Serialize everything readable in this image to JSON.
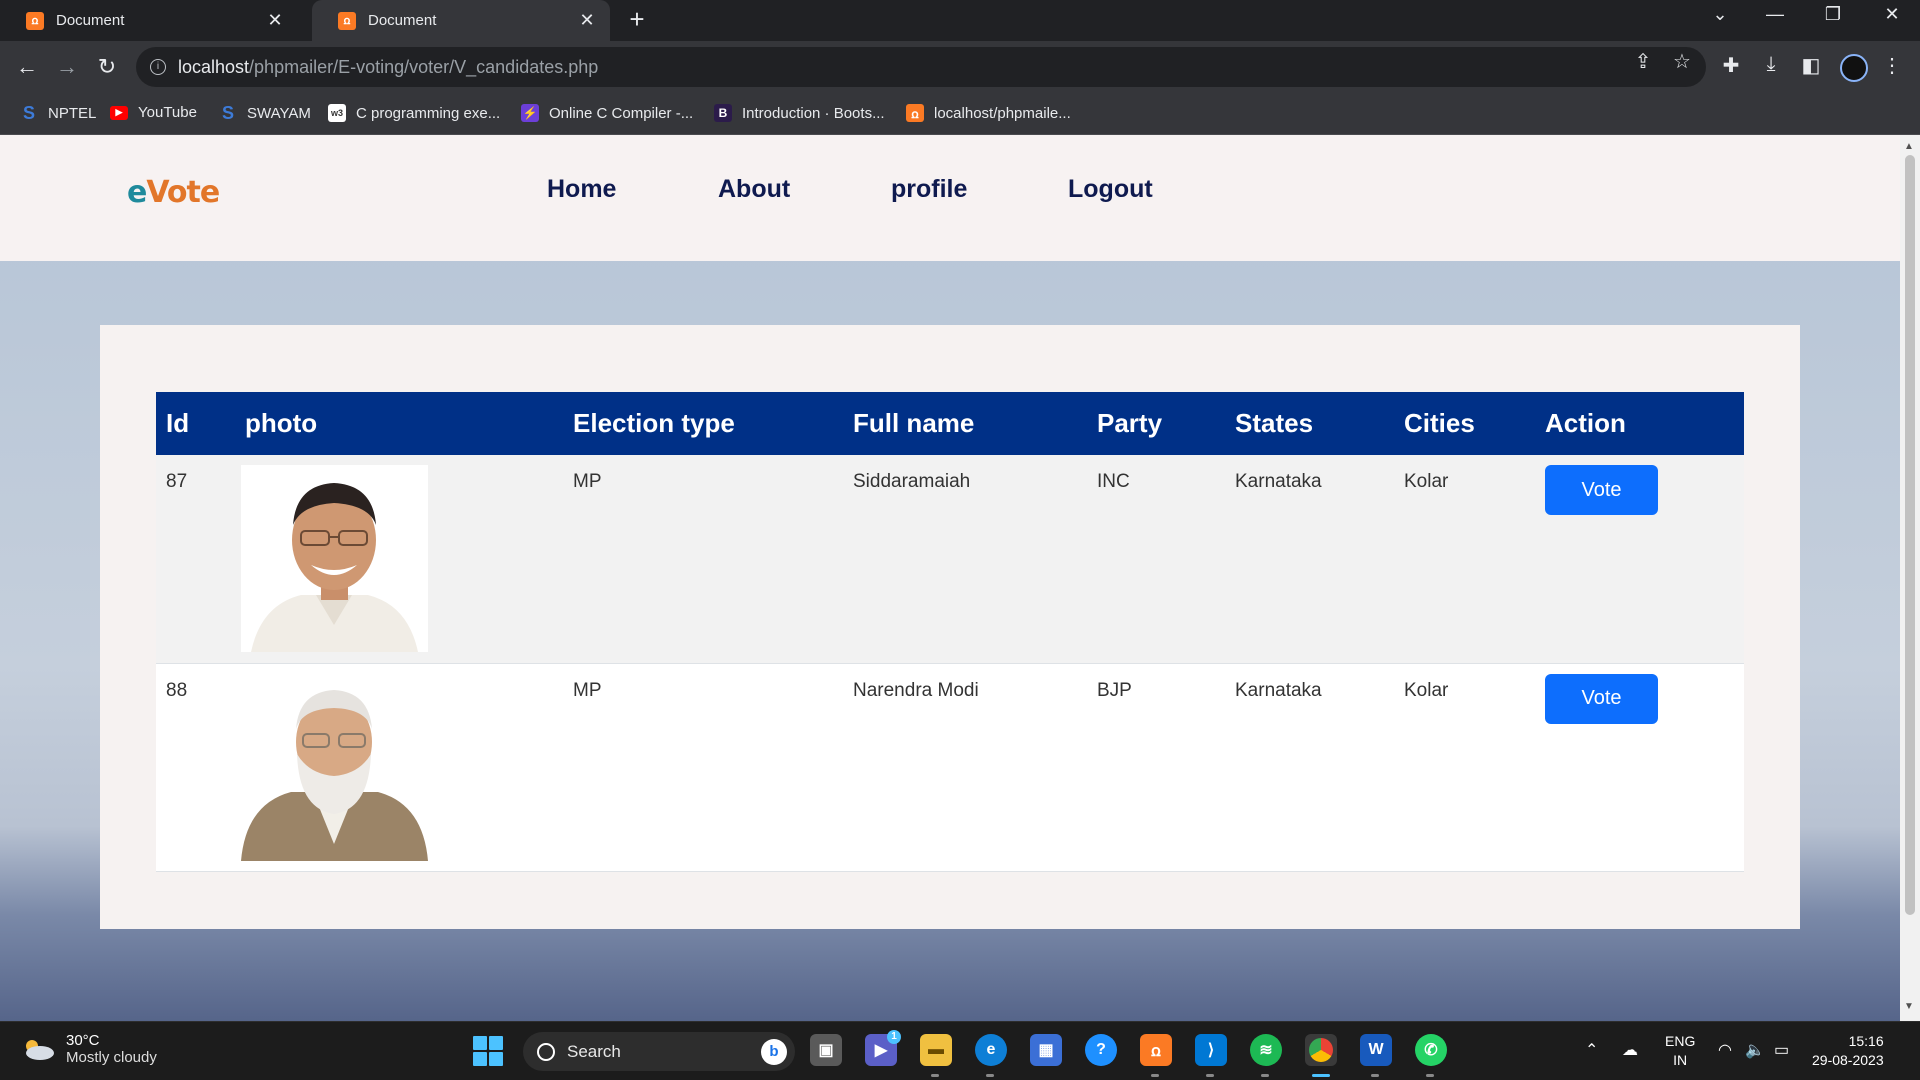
{
  "browser": {
    "tabs": [
      {
        "title": "Document",
        "active": false
      },
      {
        "title": "Document",
        "active": true
      }
    ],
    "url_host": "localhost",
    "url_path": "/phpmailer/E-voting/voter/V_candidates.php",
    "bookmarks": [
      {
        "label": "NPTEL",
        "icon": "swayam-s-icon"
      },
      {
        "label": "YouTube",
        "icon": "youtube-icon"
      },
      {
        "label": "SWAYAM",
        "icon": "swayam-s-icon"
      },
      {
        "label": "C programming exe...",
        "icon": "w3schools-icon"
      },
      {
        "label": "Online C Compiler -...",
        "icon": "bolt-icon"
      },
      {
        "label": "Introduction · Boots...",
        "icon": "bootstrap-icon"
      },
      {
        "label": "localhost/phpmaile...",
        "icon": "xampp-icon"
      }
    ]
  },
  "site": {
    "logo_e": "e",
    "logo_rest": "Vote",
    "nav": [
      "Home",
      "About",
      "profile",
      "Logout"
    ]
  },
  "table": {
    "headers": [
      "Id",
      "photo",
      "Election type",
      "Full name",
      "Party",
      "States",
      "Cities",
      "Action"
    ],
    "rows": [
      {
        "id": "87",
        "election_type": "MP",
        "full_name": "Siddaramaiah",
        "party": "INC",
        "state": "Karnataka",
        "city": "Kolar",
        "action": "Vote"
      },
      {
        "id": "88",
        "election_type": "MP",
        "full_name": "Narendra Modi",
        "party": "BJP",
        "state": "Karnataka",
        "city": "Kolar",
        "action": "Vote"
      }
    ]
  },
  "taskbar": {
    "weather_temp": "30°C",
    "weather_desc": "Mostly cloudy",
    "search_label": "Search",
    "lang_top": "ENG",
    "lang_bottom": "IN",
    "time": "15:16",
    "date": "29-08-2023",
    "teams_badge": "1"
  },
  "colors": {
    "table_header": "#003087",
    "vote_button": "#0d6efd",
    "nav_text": "#0f1a4f",
    "logo_orange": "#e2762a",
    "logo_teal": "#1f8a9c"
  }
}
